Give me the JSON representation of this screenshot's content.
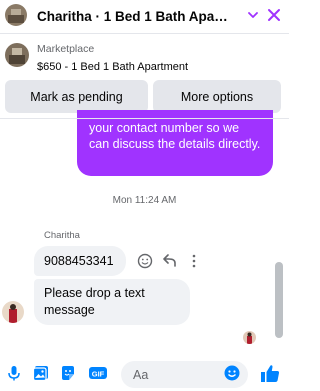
{
  "header": {
    "title": "Charitha · 1 Bed 1 Bath Apa…",
    "accent": "#a033ff"
  },
  "listing": {
    "label": "Marketplace",
    "title": "$650 - 1 Bed 1 Bath Apartment"
  },
  "actions": {
    "pending_label": "Mark as pending",
    "more_label": "More options"
  },
  "messages": {
    "outgoing_text": "your contact number so we can discuss the details directly.",
    "timestamp": "Mon 11:24 AM",
    "sender_name": "Charitha",
    "incoming": [
      "9088453341",
      "Please drop a text message"
    ]
  },
  "composer": {
    "placeholder": "Aa",
    "icons": [
      "mic-icon",
      "image-icon",
      "sticker-icon",
      "gif-icon",
      "emoji-icon",
      "like-icon"
    ]
  },
  "colors": {
    "accent": "#a033ff",
    "bubble_in": "#f0f2f5",
    "icon": "#0084ff"
  }
}
